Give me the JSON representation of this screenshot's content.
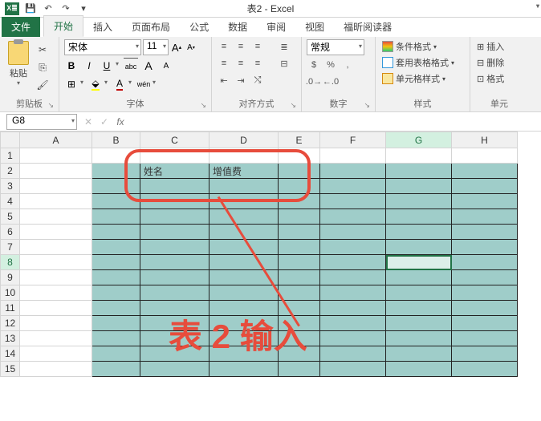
{
  "title": "表2 - Excel",
  "qat": {
    "save": "💾",
    "undo": "↶",
    "redo": "↷",
    "more": "▾"
  },
  "tabs": {
    "file": "文件",
    "items": [
      "开始",
      "插入",
      "页面布局",
      "公式",
      "数据",
      "审阅",
      "视图",
      "福昕阅读器"
    ],
    "active": 0
  },
  "ribbon": {
    "clipboard": {
      "label": "剪贴板",
      "paste": "粘贴"
    },
    "font": {
      "label": "字体",
      "name": "宋体",
      "size": "11",
      "increase": "A",
      "decrease": "A",
      "bold": "B",
      "italic": "I",
      "underline": "U",
      "phonetic": "abc",
      "border": "⊞",
      "fill": "⬛",
      "color": "A",
      "ruby": "wén"
    },
    "align": {
      "label": "对齐方式"
    },
    "number": {
      "label": "数字",
      "format": "常规",
      "currency": "%",
      "comma": ","
    },
    "styles": {
      "label": "样式",
      "conditional": "条件格式",
      "table": "套用表格格式",
      "cell": "单元格样式"
    },
    "cells": {
      "label": "单元",
      "insert": "插入",
      "delete": "删除",
      "format": "格式"
    }
  },
  "formula_bar": {
    "name_box": "G8",
    "fx": "fx",
    "value": ""
  },
  "grid": {
    "columns": [
      "A",
      "B",
      "C",
      "D",
      "E",
      "F",
      "G",
      "H"
    ],
    "rows": [
      1,
      2,
      3,
      4,
      5,
      6,
      7,
      8,
      9,
      10,
      11,
      12,
      13,
      14,
      15
    ],
    "active_row": 8,
    "active_col": "G",
    "selected": "G8",
    "shaded_range": {
      "col_start": "B",
      "col_end": "H",
      "row_start": 2,
      "row_end": 15
    },
    "cells": {
      "C2": "姓名",
      "D2": "增值费"
    }
  },
  "annotation": {
    "box_target": "C2:E4",
    "text": "表 2 输入"
  }
}
